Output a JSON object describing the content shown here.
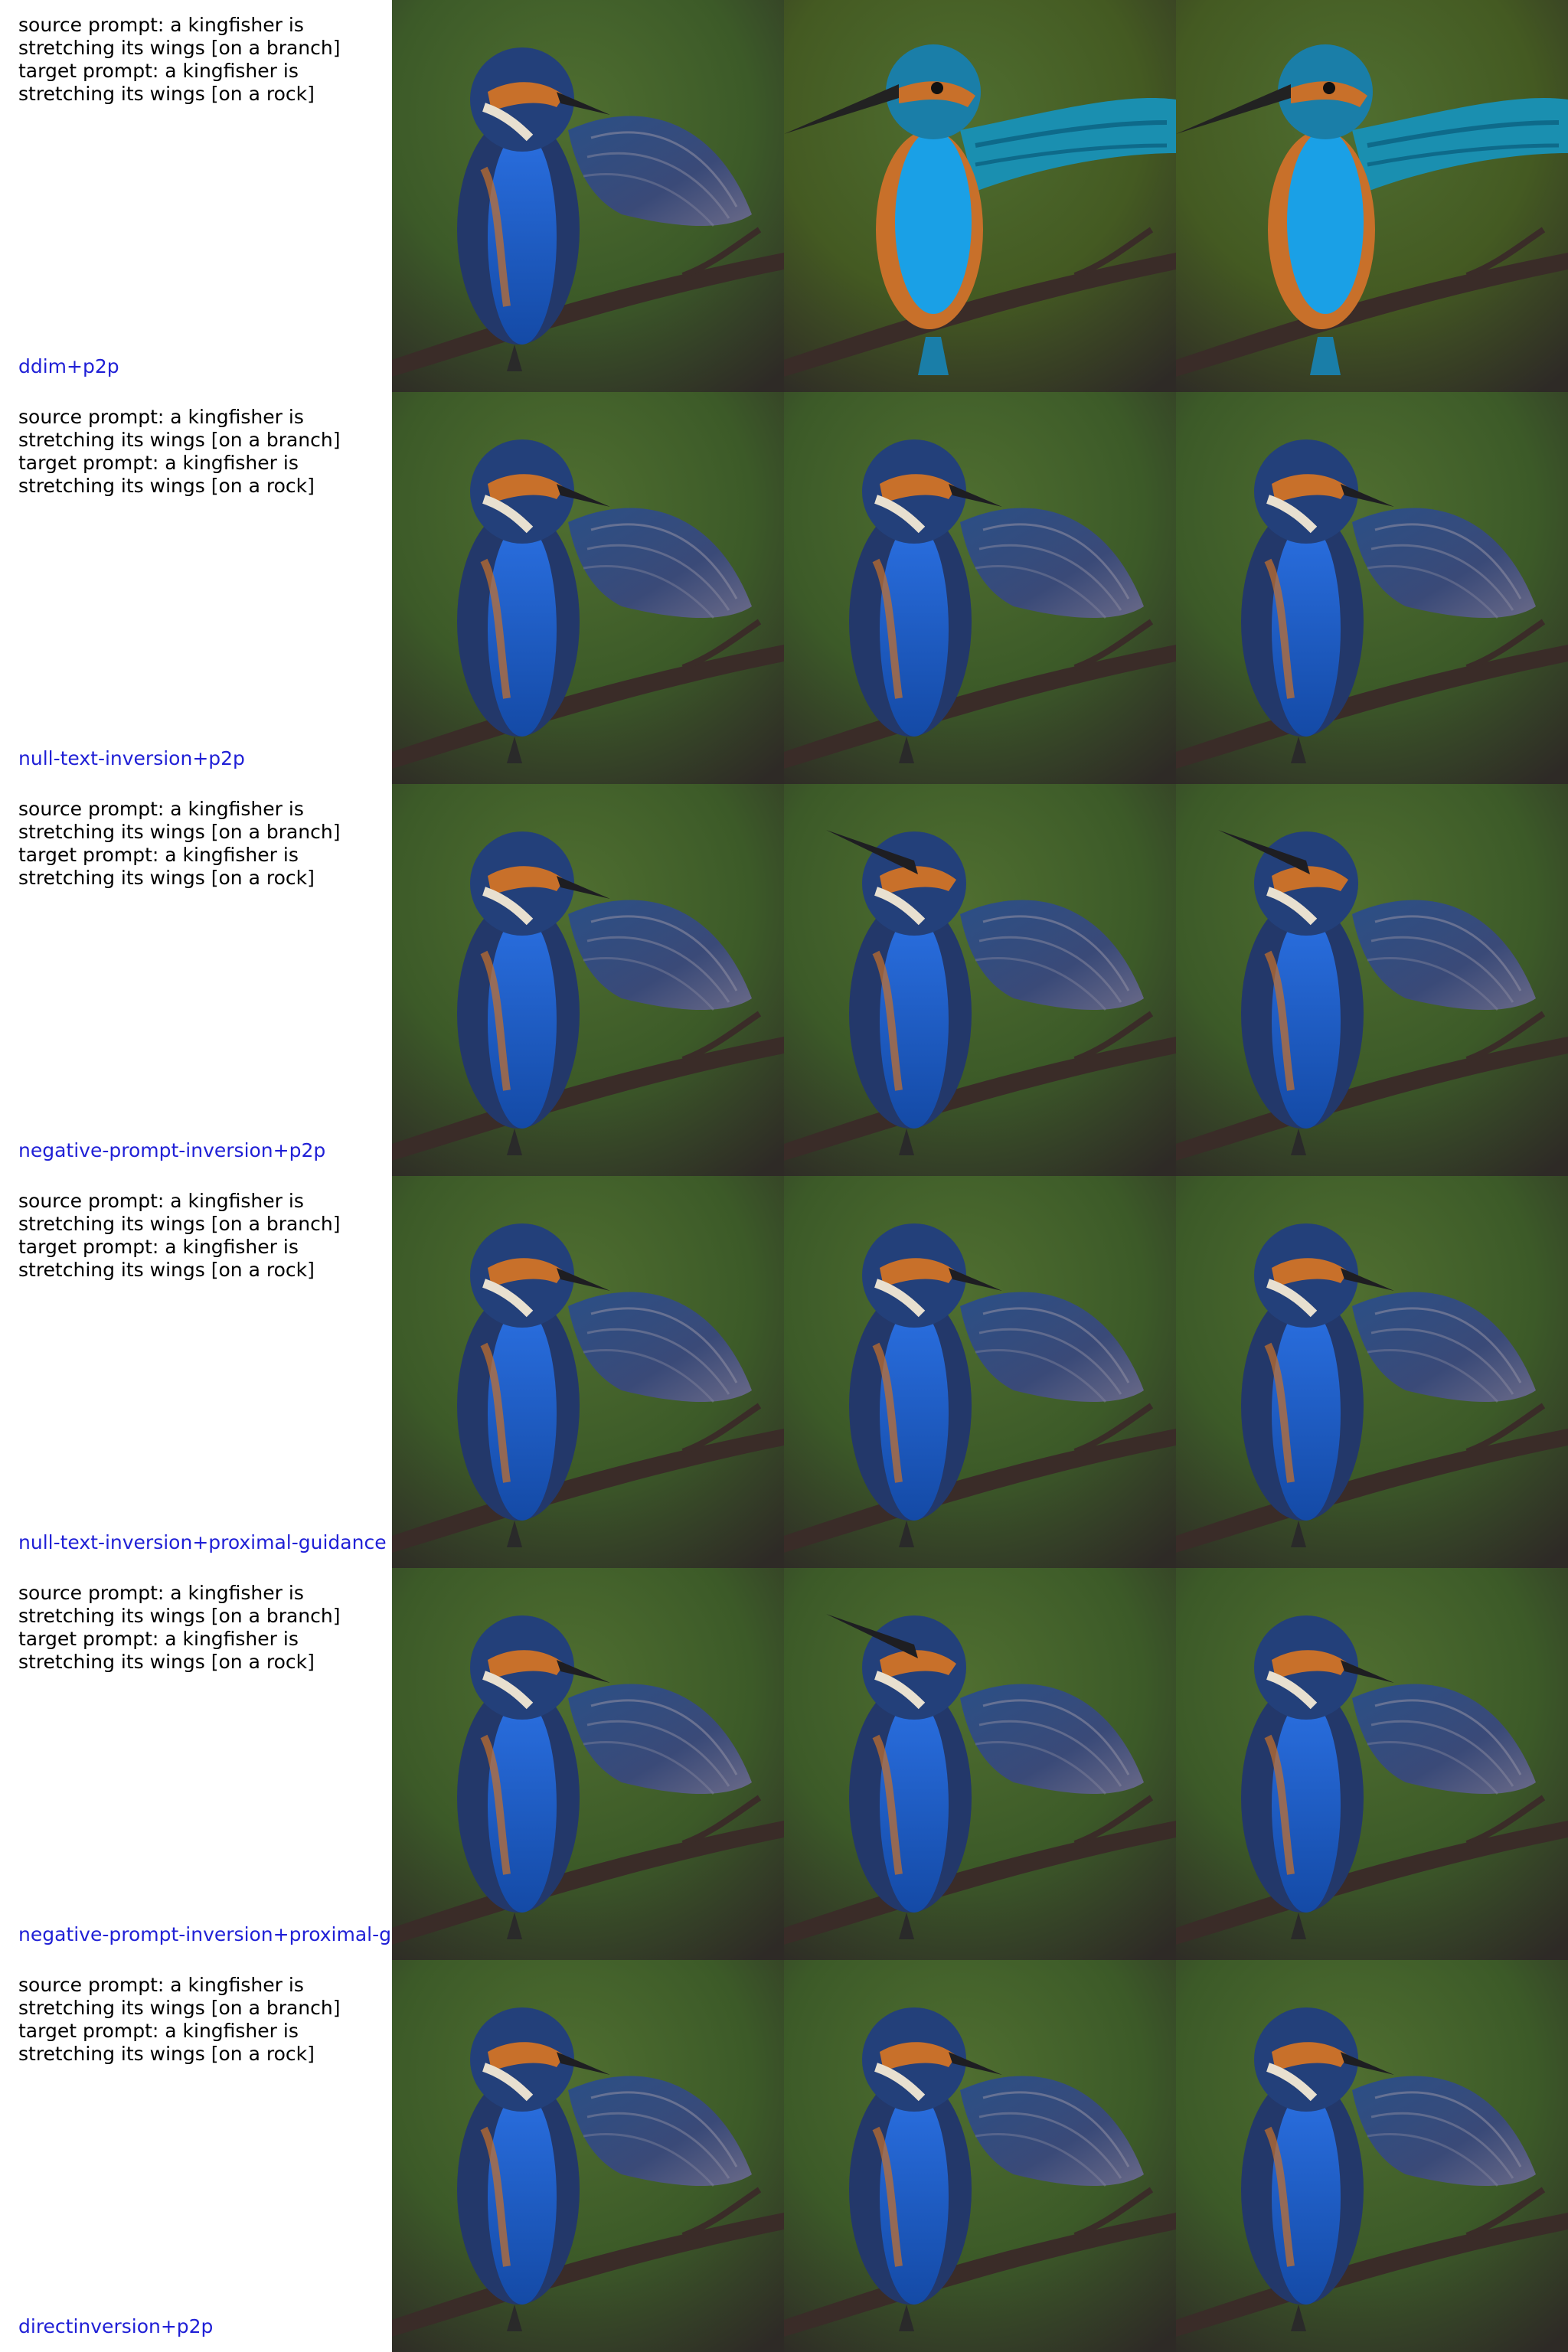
{
  "rows": [
    {
      "method": "ddim+p2p",
      "source_lines": [
        "source prompt: a kingfisher is",
        "stretching its wings [on a branch]"
      ],
      "target_lines": [
        "target prompt: a kingfisher is",
        "stretching its wings [on a rock]"
      ]
    },
    {
      "method": "null-text-inversion+p2p",
      "source_lines": [
        "source prompt: a kingfisher is",
        "stretching its wings [on a branch]"
      ],
      "target_lines": [
        "target prompt: a kingfisher is",
        "stretching its wings [on a rock]"
      ]
    },
    {
      "method": "negative-prompt-inversion+p2p",
      "source_lines": [
        "source prompt: a kingfisher is",
        "stretching its wings [on a branch]"
      ],
      "target_lines": [
        "target prompt: a kingfisher is",
        "stretching its wings [on a rock]"
      ]
    },
    {
      "method": "null-text-inversion+proximal-guidance",
      "source_lines": [
        "source prompt: a kingfisher is",
        "stretching its wings [on a branch]"
      ],
      "target_lines": [
        "target prompt: a kingfisher is",
        "stretching its wings [on a rock]"
      ]
    },
    {
      "method": "negative-prompt-inversion+proximal-g",
      "source_lines": [
        "source prompt: a kingfisher is",
        "stretching its wings [on a branch]"
      ],
      "target_lines": [
        "target prompt: a kingfisher is",
        "stretching its wings [on a rock]"
      ]
    },
    {
      "method": "directinversion+p2p",
      "source_lines": [
        "source prompt: a kingfisher is",
        "stretching its wings [on a branch]"
      ],
      "target_lines": [
        "target prompt: a kingfisher is",
        "stretching its wings [on a rock]"
      ]
    }
  ],
  "colors": {
    "method_label": "#1f1fd6",
    "background_green": "#3c5a28",
    "bird_blue": "#1a5fcc",
    "bird_orange": "#c8702a",
    "branch": "#3a2c28"
  }
}
